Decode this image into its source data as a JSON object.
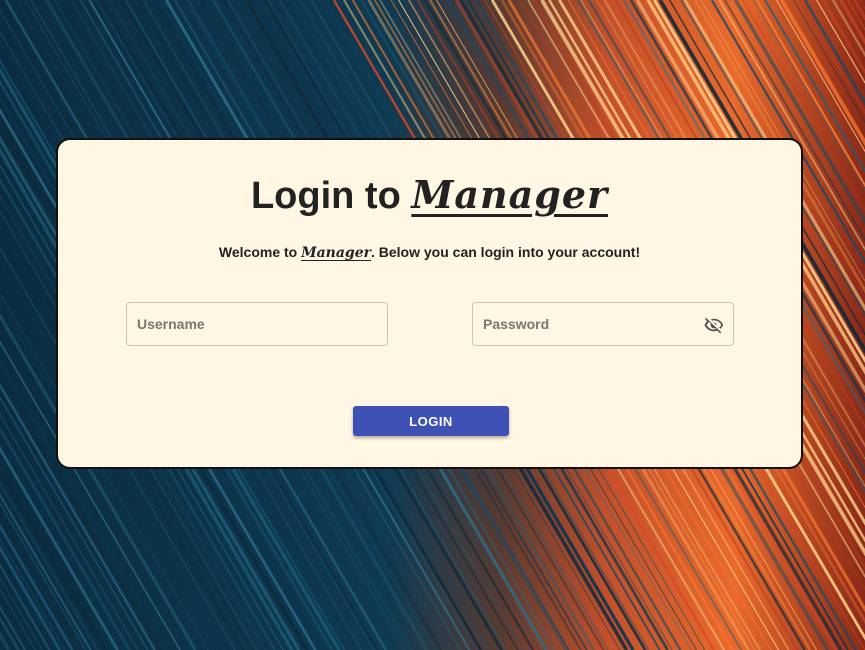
{
  "login_card": {
    "title_prefix": "Login to ",
    "brand_name": "Manager",
    "welcome_prefix": "Welcome to ",
    "welcome_suffix": ". Below you can login into your account!",
    "username": {
      "placeholder": "Username",
      "value": ""
    },
    "password": {
      "placeholder": "Password",
      "value": "",
      "visibility_icon": "eye-off-icon"
    },
    "login_button": {
      "label": "LOGIN"
    }
  },
  "colors": {
    "card_background": "#fff6e3",
    "button_primary": "#3f51b5",
    "background_dark": "#06202f",
    "background_accent": "#e8662a"
  }
}
